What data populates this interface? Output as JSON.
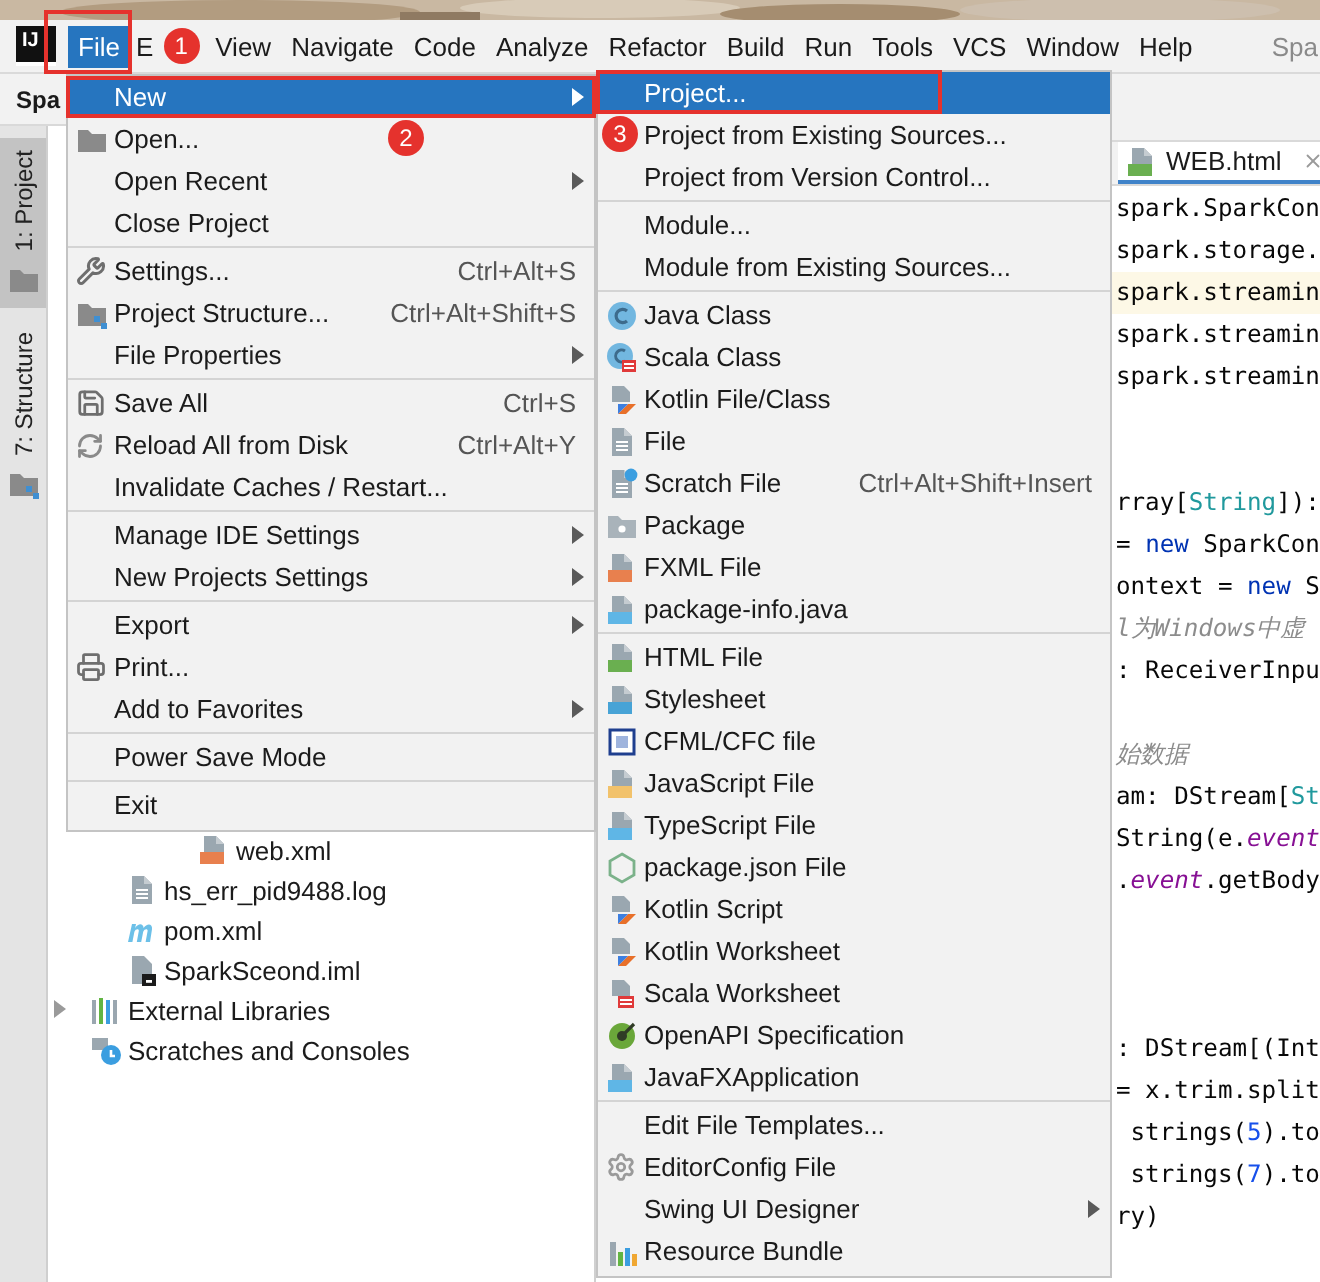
{
  "menubar": {
    "logo_text": "IJ",
    "items": [
      {
        "label": "File",
        "selected": true
      },
      {
        "label": "E",
        "selected": false
      },
      {
        "label": "View",
        "selected": false
      },
      {
        "label": "Navigate",
        "selected": false
      },
      {
        "label": "Code",
        "selected": false
      },
      {
        "label": "Analyze",
        "selected": false
      },
      {
        "label": "Refactor",
        "selected": false
      },
      {
        "label": "Build",
        "selected": false
      },
      {
        "label": "Run",
        "selected": false
      },
      {
        "label": "Tools",
        "selected": false
      },
      {
        "label": "VCS",
        "selected": false
      },
      {
        "label": "Window",
        "selected": false
      },
      {
        "label": "Help",
        "selected": false
      }
    ],
    "title_text": "Spa"
  },
  "project_panel": {
    "title": "Spa",
    "tool_tabs": [
      {
        "label": "1: Project",
        "selected": true
      },
      {
        "label": "7: Structure",
        "selected": false
      }
    ],
    "tree": [
      {
        "children": [
          {
            "children": [
              {
                "children": [
                  {
                    "label": "web.xml"
                  }
                ]
              }
            ]
          },
          {
            "label": "hs_err_pid9488.log"
          },
          {
            "label": "pom.xml"
          },
          {
            "label": "SparkSceond.iml"
          }
        ]
      },
      {
        "label": "External Libraries",
        "expanded": false
      },
      {
        "label": "Scratches and Consoles"
      }
    ]
  },
  "file_menu": {
    "items": [
      {
        "kind": "item",
        "label": "New",
        "submenu": true,
        "selected": true
      },
      {
        "kind": "item",
        "label": "Open...",
        "submenu": false,
        "selected": false
      },
      {
        "kind": "item",
        "label": "Open Recent",
        "submenu": true,
        "selected": false
      },
      {
        "kind": "item",
        "label": "Close Project",
        "submenu": false,
        "selected": false
      },
      {
        "kind": "separator"
      },
      {
        "kind": "item",
        "label": "Settings...",
        "shortcut": "Ctrl+Alt+S",
        "submenu": false,
        "selected": false
      },
      {
        "kind": "item",
        "label": "Project Structure...",
        "shortcut": "Ctrl+Alt+Shift+S",
        "submenu": false,
        "selected": false
      },
      {
        "kind": "item",
        "label": "File Properties",
        "submenu": true,
        "selected": false
      },
      {
        "kind": "separator"
      },
      {
        "kind": "item",
        "label": "Save All",
        "shortcut": "Ctrl+S",
        "submenu": false,
        "selected": false
      },
      {
        "kind": "item",
        "label": "Reload All from Disk",
        "shortcut": "Ctrl+Alt+Y",
        "submenu": false,
        "selected": false
      },
      {
        "kind": "item",
        "label": "Invalidate Caches / Restart...",
        "submenu": false,
        "selected": false
      },
      {
        "kind": "separator"
      },
      {
        "kind": "item",
        "label": "Manage IDE Settings",
        "submenu": true,
        "selected": false
      },
      {
        "kind": "item",
        "label": "New Projects Settings",
        "submenu": true,
        "selected": false
      },
      {
        "kind": "separator"
      },
      {
        "kind": "item",
        "label": "Export",
        "submenu": true,
        "selected": false
      },
      {
        "kind": "item",
        "label": "Print...",
        "submenu": false,
        "selected": false
      },
      {
        "kind": "item",
        "label": "Add to Favorites",
        "submenu": true,
        "selected": false
      },
      {
        "kind": "separator"
      },
      {
        "kind": "item",
        "label": "Power Save Mode",
        "submenu": false,
        "selected": false
      },
      {
        "kind": "separator"
      },
      {
        "kind": "item",
        "label": "Exit",
        "submenu": false,
        "selected": false
      }
    ]
  },
  "new_submenu": {
    "items": [
      {
        "kind": "item",
        "label": "Project...",
        "submenu": false,
        "selected": true
      },
      {
        "kind": "item",
        "label": "Project from Existing Sources...",
        "submenu": false,
        "selected": false
      },
      {
        "kind": "item",
        "label": "Project from Version Control...",
        "submenu": false,
        "selected": false
      },
      {
        "kind": "separator"
      },
      {
        "kind": "item",
        "label": "Module...",
        "submenu": false,
        "selected": false
      },
      {
        "kind": "item",
        "label": "Module from Existing Sources...",
        "submenu": false,
        "selected": false
      },
      {
        "kind": "separator"
      },
      {
        "kind": "item",
        "label": "Java Class",
        "submenu": false,
        "selected": false
      },
      {
        "kind": "item",
        "label": "Scala Class",
        "submenu": false,
        "selected": false
      },
      {
        "kind": "item",
        "label": "Kotlin File/Class",
        "submenu": false,
        "selected": false
      },
      {
        "kind": "item",
        "label": "File",
        "submenu": false,
        "selected": false
      },
      {
        "kind": "item",
        "label": "Scratch File",
        "shortcut": "Ctrl+Alt+Shift+Insert",
        "submenu": false,
        "selected": false
      },
      {
        "kind": "item",
        "label": "Package",
        "submenu": false,
        "selected": false
      },
      {
        "kind": "item",
        "label": "FXML File",
        "submenu": false,
        "selected": false
      },
      {
        "kind": "item",
        "label": "package-info.java",
        "submenu": false,
        "selected": false
      },
      {
        "kind": "separator"
      },
      {
        "kind": "item",
        "label": "HTML File",
        "submenu": false,
        "selected": false
      },
      {
        "kind": "item",
        "label": "Stylesheet",
        "submenu": false,
        "selected": false
      },
      {
        "kind": "item",
        "label": "CFML/CFC file",
        "submenu": false,
        "selected": false
      },
      {
        "kind": "item",
        "label": "JavaScript File",
        "submenu": false,
        "selected": false
      },
      {
        "kind": "item",
        "label": "TypeScript File",
        "submenu": false,
        "selected": false
      },
      {
        "kind": "item",
        "label": "package.json File",
        "submenu": false,
        "selected": false
      },
      {
        "kind": "item",
        "label": "Kotlin Script",
        "submenu": false,
        "selected": false
      },
      {
        "kind": "item",
        "label": "Kotlin Worksheet",
        "submenu": false,
        "selected": false
      },
      {
        "kind": "item",
        "label": "Scala Worksheet",
        "submenu": false,
        "selected": false
      },
      {
        "kind": "item",
        "label": "OpenAPI Specification",
        "submenu": false,
        "selected": false
      },
      {
        "kind": "item",
        "label": "JavaFXApplication",
        "submenu": false,
        "selected": false
      },
      {
        "kind": "separator"
      },
      {
        "kind": "item",
        "label": "Edit File Templates...",
        "submenu": false,
        "selected": false
      },
      {
        "kind": "item",
        "label": "EditorConfig File",
        "submenu": false,
        "selected": false
      },
      {
        "kind": "item",
        "label": "Swing UI Designer",
        "submenu": true,
        "selected": false
      },
      {
        "kind": "item",
        "label": "Resource Bundle",
        "submenu": false,
        "selected": false
      }
    ]
  },
  "editor": {
    "tabs": [
      {
        "label": "WEB.html",
        "selected": true
      }
    ],
    "lines": [
      {
        "kind": "code",
        "current": false,
        "segments": [
          {
            "kind": "plain",
            "text": "spark.SparkCon"
          }
        ]
      },
      {
        "kind": "code",
        "current": false,
        "segments": [
          {
            "kind": "plain",
            "text": "spark.storage."
          }
        ]
      },
      {
        "kind": "code",
        "current": true,
        "segments": [
          {
            "kind": "plain",
            "text": "spark.streamin"
          }
        ]
      },
      {
        "kind": "code",
        "current": false,
        "segments": [
          {
            "kind": "plain",
            "text": "spark.streamin"
          }
        ]
      },
      {
        "kind": "code",
        "current": false,
        "segments": [
          {
            "kind": "plain",
            "text": "spark.streamin"
          }
        ]
      },
      {
        "kind": "blank"
      },
      {
        "kind": "blank"
      },
      {
        "kind": "code",
        "current": false,
        "segments": [
          {
            "kind": "plain",
            "text": "rray["
          },
          {
            "kind": "type",
            "text": "String"
          },
          {
            "kind": "plain",
            "text": "]):"
          }
        ]
      },
      {
        "kind": "code",
        "current": false,
        "segments": [
          {
            "kind": "plain",
            "text": "= "
          },
          {
            "kind": "keyword",
            "text": "new"
          },
          {
            "kind": "plain",
            "text": " SparkCon"
          }
        ]
      },
      {
        "kind": "code",
        "current": false,
        "segments": [
          {
            "kind": "plain",
            "text": "ontext = "
          },
          {
            "kind": "keyword",
            "text": "new"
          },
          {
            "kind": "plain",
            "text": " S"
          }
        ]
      },
      {
        "kind": "code",
        "current": false,
        "segments": [
          {
            "kind": "comment",
            "text": "l为Windows中虚"
          }
        ]
      },
      {
        "kind": "code",
        "current": false,
        "segments": [
          {
            "kind": "plain",
            "text": ": ReceiverInpu"
          }
        ]
      },
      {
        "kind": "blank"
      },
      {
        "kind": "code",
        "current": false,
        "segments": [
          {
            "kind": "comment",
            "text": "始数据"
          }
        ]
      },
      {
        "kind": "code",
        "current": false,
        "segments": [
          {
            "kind": "plain",
            "text": "am: DStream["
          },
          {
            "kind": "type",
            "text": "St"
          }
        ]
      },
      {
        "kind": "code",
        "current": false,
        "segments": [
          {
            "kind": "plain",
            "text": "String(e."
          },
          {
            "kind": "field",
            "text": "event"
          }
        ]
      },
      {
        "kind": "code",
        "current": false,
        "segments": [
          {
            "kind": "plain",
            "text": "."
          },
          {
            "kind": "field",
            "text": "event"
          },
          {
            "kind": "plain",
            "text": ".getBody"
          }
        ]
      },
      {
        "kind": "blank"
      },
      {
        "kind": "blank"
      },
      {
        "kind": "blank"
      },
      {
        "kind": "code",
        "current": false,
        "segments": [
          {
            "kind": "plain",
            "text": ": DStream[(Int"
          }
        ]
      },
      {
        "kind": "code",
        "current": false,
        "segments": [
          {
            "kind": "plain",
            "text": "= x.trim.split"
          }
        ]
      },
      {
        "kind": "code",
        "current": false,
        "segments": [
          {
            "kind": "plain",
            "text": " strings("
          },
          {
            "kind": "number",
            "text": "5"
          },
          {
            "kind": "plain",
            "text": ").to"
          }
        ]
      },
      {
        "kind": "code",
        "current": false,
        "segments": [
          {
            "kind": "plain",
            "text": " strings("
          },
          {
            "kind": "number",
            "text": "7"
          },
          {
            "kind": "plain",
            "text": ").to"
          }
        ]
      },
      {
        "kind": "code",
        "current": false,
        "segments": [
          {
            "kind": "plain",
            "text": "ry)"
          }
        ]
      }
    ]
  },
  "annotations": [
    {
      "label": "1"
    },
    {
      "label": "2"
    },
    {
      "label": "3"
    }
  ]
}
